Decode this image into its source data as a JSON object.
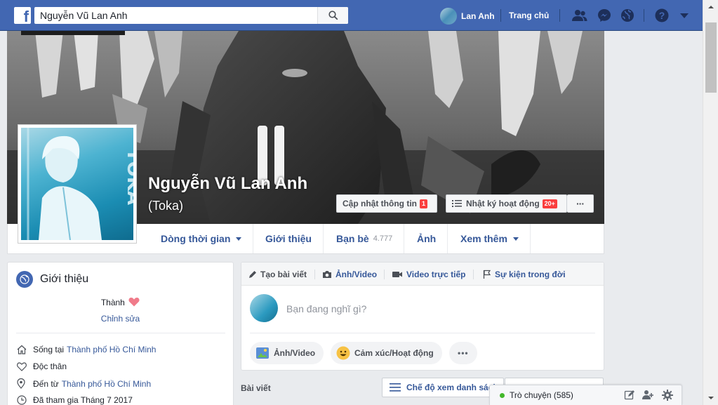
{
  "topbar": {
    "logo": "f",
    "search_value": "Nguyễn Vũ Lan Anh",
    "user_name": "Lan Anh",
    "home_label": "Trang chủ",
    "icons": [
      "search-icon",
      "friend-requests-icon",
      "messenger-icon",
      "notifications-globe-icon",
      "help-icon",
      "account-menu-caret-icon"
    ],
    "brand_color": "#4267b2"
  },
  "profile": {
    "name": "Nguyễn Vũ Lan Anh",
    "alternate_name": "(Toka)",
    "update_info_label": "Cập nhật thông tin",
    "update_info_badge": "1",
    "activity_log_label": "Nhật ký hoạt động",
    "activity_log_badge": "20+",
    "more_label": "···"
  },
  "profile_nav": {
    "timeline": "Dòng thời gian",
    "about": "Giới thiệu",
    "friends": "Bạn bè",
    "friends_count": "4.777",
    "photos": "Ảnh",
    "more": "Xem thêm"
  },
  "intro": {
    "title": "Giới thiệu",
    "bio": "Thành",
    "edit": "Chỉnh sửa",
    "lives_in_prefix": "Sống tại",
    "lives_in_link": "Thành phố Hồ Chí Minh",
    "relationship": "Độc thân",
    "from_prefix": "Đến từ",
    "from_link": "Thành phố Hồ Chí Minh",
    "joined": "Đã tham gia Tháng 7 2017"
  },
  "composer": {
    "tab_create_post": "Tạo bài viết",
    "tab_photo_video": "Ảnh/Video",
    "tab_live_video": "Video trực tiếp",
    "tab_life_event": "Sự kiện trong đời",
    "placeholder": "Bạn đang nghĩ gì?",
    "pill_photo_video": "Ảnh/Video",
    "pill_feeling": "Cảm xúc/Hoạt động",
    "pill_more": "•••"
  },
  "posts": {
    "label": "Bài viết",
    "view_mode": "Chế độ xem danh sách"
  },
  "chat": {
    "label": "Trò chuyện (585)",
    "status_color": "#42b72a"
  }
}
